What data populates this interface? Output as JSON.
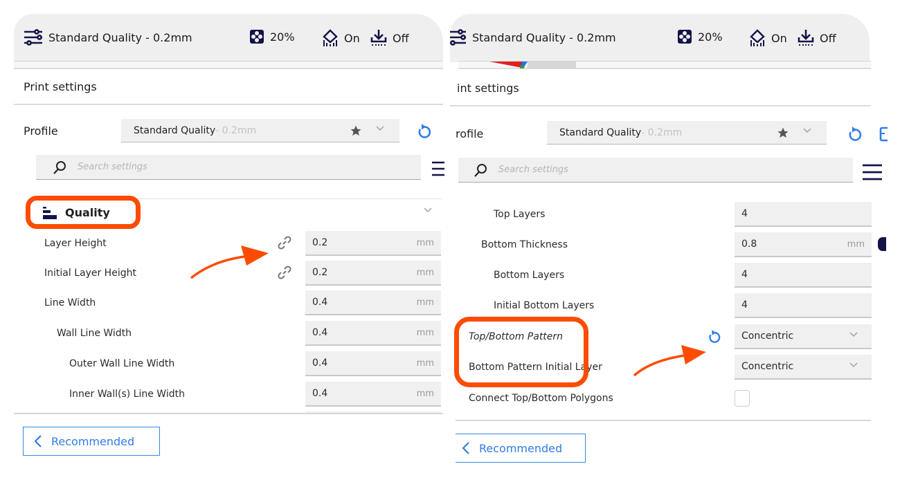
{
  "colors": {
    "annotation": "#fc4c02",
    "accent_blue": "#2f7ce8",
    "icon_navy": "#13134a",
    "header_bg": "#efefef",
    "field_bg": "#f0f0f0"
  },
  "left": {
    "header": {
      "profile_icon": "settings-sliders-icon",
      "profile_text": "Standard Quality - 0.2mm",
      "infill_icon": "infill-icon",
      "infill_value": "20%",
      "support_icon": "support-icon",
      "support_value": "On",
      "adhesion_icon": "adhesion-icon",
      "adhesion_value": "Off"
    },
    "title": "Print settings",
    "profile": {
      "label": "Profile",
      "name": "Standard Quality",
      "suffix": " - 0.2mm"
    },
    "search": {
      "placeholder": "Search settings"
    },
    "category": {
      "icon": "quality-icon",
      "label": "Quality"
    },
    "settings": [
      {
        "label": "Layer Height",
        "value": "0.2",
        "unit": "mm",
        "link_icon": true
      },
      {
        "label": "Initial Layer Height",
        "value": "0.2",
        "unit": "mm",
        "link_icon": true
      },
      {
        "label": "Line Width",
        "value": "0.4",
        "unit": "mm"
      },
      {
        "label": "Wall Line Width",
        "value": "0.4",
        "unit": "mm"
      },
      {
        "label": "Outer Wall Line Width",
        "value": "0.4",
        "unit": "mm"
      },
      {
        "label": "Inner Wall(s) Line Width",
        "value": "0.4",
        "unit": "mm"
      }
    ],
    "recommended_label": "Recommended"
  },
  "right": {
    "header": {
      "profile_text": "Standard Quality - 0.2mm",
      "infill_value": "20%",
      "support_value": "On",
      "adhesion_value": "Off"
    },
    "title": "int settings",
    "profile": {
      "label": "rofile",
      "name": "Standard Quality",
      "suffix": " - 0.2mm"
    },
    "search": {
      "placeholder": "Search settings"
    },
    "settings": [
      {
        "label": "Top Layers",
        "value": "4",
        "unit": ""
      },
      {
        "label": "Bottom Thickness",
        "value": "0.8",
        "unit": "mm"
      },
      {
        "label": "Bottom Layers",
        "value": "4",
        "unit": ""
      },
      {
        "label": "Initial Bottom Layers",
        "value": "4",
        "unit": ""
      },
      {
        "label": "Top/Bottom Pattern",
        "value": "Concentric",
        "type": "dropdown",
        "modified": true
      },
      {
        "label": "Bottom Pattern Initial Layer",
        "value": "Concentric",
        "type": "dropdown"
      },
      {
        "label": "Connect Top/Bottom Polygons",
        "value": false,
        "type": "checkbox"
      }
    ],
    "recommended_label": "Recommended"
  }
}
